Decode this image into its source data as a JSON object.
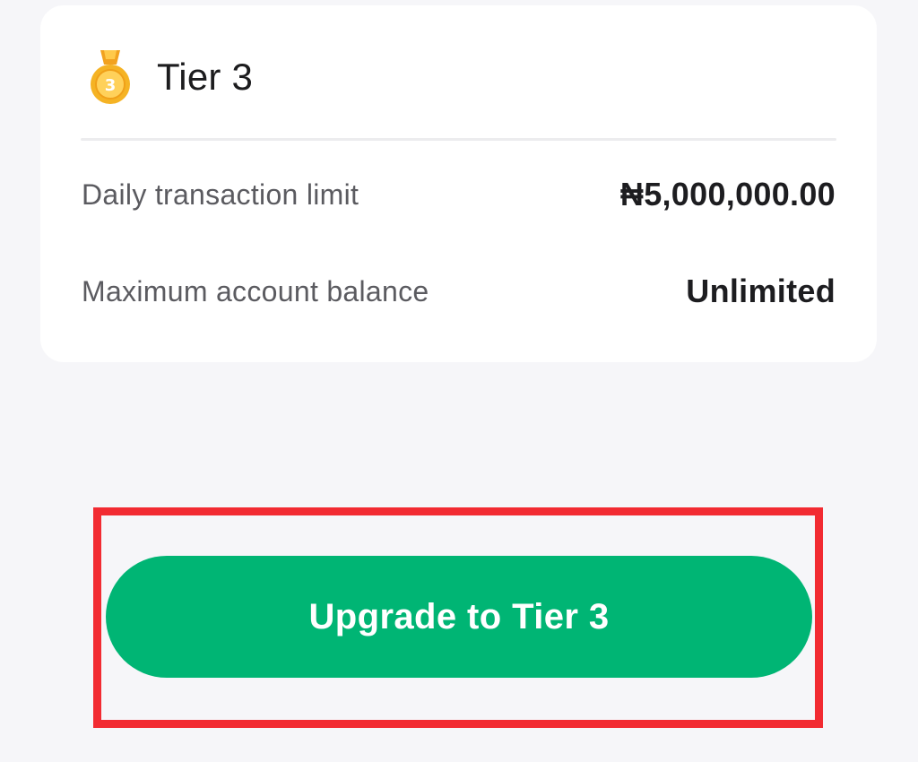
{
  "tier_card": {
    "title": "Tier 3",
    "medal_icon": "medal-icon",
    "medal_number": "3",
    "rows": [
      {
        "label": "Daily transaction limit",
        "value": "₦5,000,000.00"
      },
      {
        "label": "Maximum account balance",
        "value": "Unlimited"
      }
    ]
  },
  "action": {
    "upgrade_label": "Upgrade to Tier 3"
  },
  "colors": {
    "background": "#f6f6f9",
    "card": "#ffffff",
    "accent_green": "#00b574",
    "highlight_red": "#f22b32",
    "medal_gold": "#f5b324"
  }
}
